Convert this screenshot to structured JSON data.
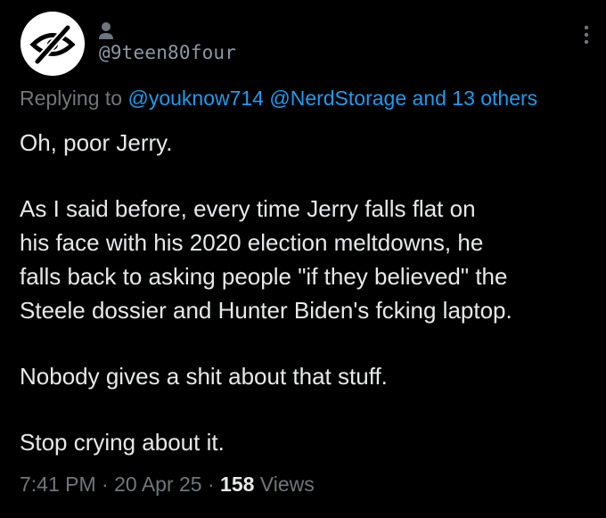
{
  "author": {
    "avatar_icon": "eye-slash-icon",
    "user_icon": "person-icon",
    "handle": "@9teen80four"
  },
  "reply": {
    "prefix": "Replying to",
    "mentions": [
      "@youknow714",
      "@NerdStorage"
    ],
    "others": "and 13 others"
  },
  "tweet": {
    "lines": [
      "Oh, poor Jerry.",
      "As I said before, every time Jerry falls flat on",
      "his face with his 2020 election meltdowns, he",
      "falls back to asking people \"if they believed\" the",
      "Steele dossier and Hunter Biden's fcking laptop.",
      "Nobody gives a shit about that stuff.",
      "Stop crying about it."
    ]
  },
  "meta": {
    "time": "7:41 PM",
    "date": "20 Apr 25",
    "separator": "·",
    "views_count": "158",
    "views_label": "Views"
  },
  "colors": {
    "background": "#000000",
    "text": "#e7e9ea",
    "muted": "#71767b",
    "link": "#1d9bf0"
  },
  "menu": {
    "more_icon": "more-vertical-icon"
  }
}
